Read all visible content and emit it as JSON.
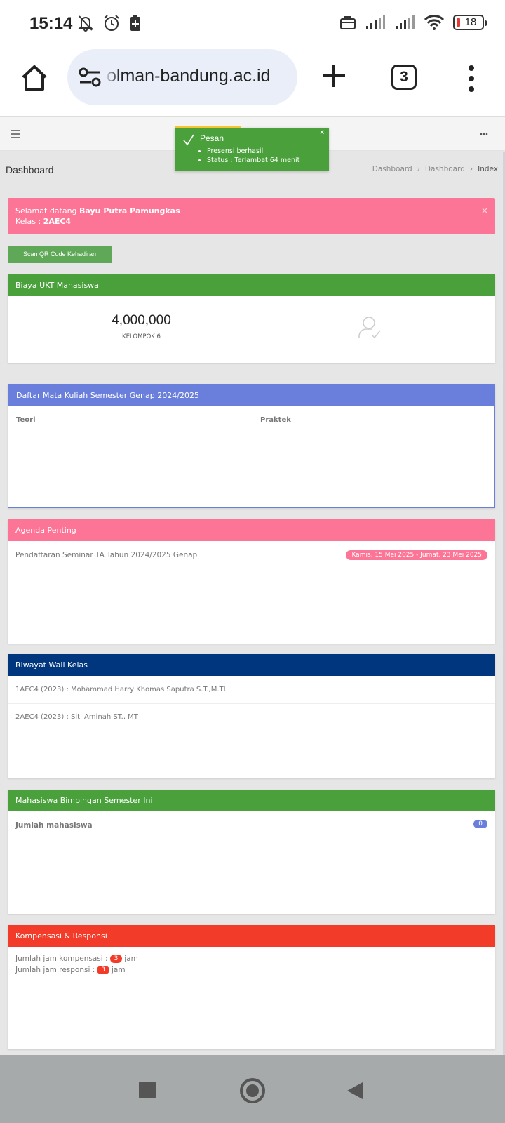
{
  "status_bar": {
    "time": "15:14",
    "battery": "18",
    "icons": [
      "bell-off-icon",
      "alarm-icon",
      "battery-saver-icon",
      "briefcase-icon",
      "signal-icon",
      "signal-icon",
      "wifi-icon",
      "battery-icon"
    ]
  },
  "browser": {
    "url": "olman-bandung.ac.id",
    "tab_count": "3"
  },
  "toast": {
    "title": "Pesan",
    "lines": [
      "Presensi berhasil",
      "Status : Terlambat 64 menit"
    ],
    "close": "×"
  },
  "page": {
    "title": "Dashboard",
    "breadcrumb": [
      "Dashboard",
      "Dashboard",
      "Index"
    ],
    "breadcrumb_sep": "›"
  },
  "welcome": {
    "greeting": "Selamat datang ",
    "name": "Bayu Putra Pamungkas",
    "class_label": "Kelas : ",
    "class_value": "2AEC4",
    "close": "×"
  },
  "scan_button": "Scan QR Code Kehadiran",
  "ukt": {
    "title": "Biaya UKT Mahasiswa",
    "amount": "4,000,000",
    "group": "KELOMPOK 6"
  },
  "courses": {
    "title": "Daftar Mata Kuliah Semester Genap 2024/2025",
    "col_theory": "Teori",
    "col_practice": "Praktek"
  },
  "agenda": {
    "title": "Agenda Penting",
    "item": "Pendaftaran Seminar TA Tahun 2024/2025 Genap",
    "date": "Kamis, 15 Mei 2025 - Jumat, 23 Mei 2025"
  },
  "wali": {
    "title": "Riwayat Wali Kelas",
    "rows": [
      "1AEC4 (2023) : Mohammad Harry Khomas Saputra S.T.,M.TI",
      "2AEC4 (2023) : Siti Aminah ST., MT"
    ]
  },
  "bimbingan": {
    "title": "Mahasiswa Bimbingan Semester Ini",
    "label": "Jumlah mahasiswa",
    "count": "0"
  },
  "kompensasi": {
    "title": "Kompensasi & Responsi",
    "komp_label": "Jumlah jam kompensasi : ",
    "komp_value": "3",
    "resp_label": "Jumlah jam responsi : ",
    "resp_value": "3",
    "unit": "jam"
  },
  "colors": {
    "green": "#4aa13c",
    "blue": "#6a7fdc",
    "pink": "#fd7596",
    "navy": "#00367d",
    "red": "#f23b28"
  }
}
